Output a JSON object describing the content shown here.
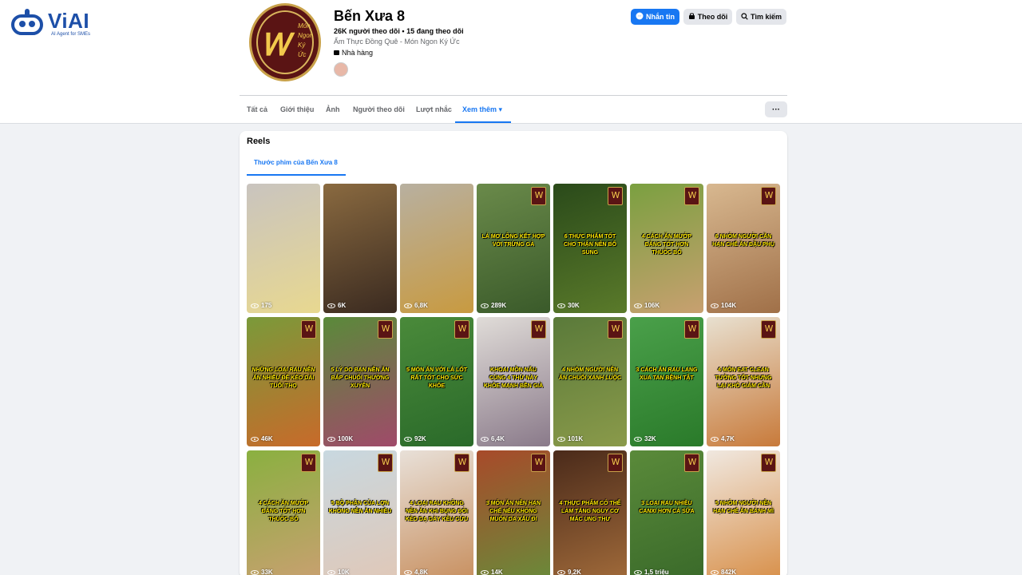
{
  "brand": {
    "name": "ViAI",
    "tagline": "AI Agent for SMEs"
  },
  "page": {
    "name": "Bến Xưa 8",
    "stats": "26K người theo dõi • 15 đang theo dõi",
    "description": "Ẩm Thực Đồng Quê - Món Ngon Ký Ức",
    "category": "Nhà hàng",
    "avatar_text": [
      "Món",
      "Ngon",
      "Ký",
      "Ức"
    ]
  },
  "actions": {
    "message": "Nhắn tin",
    "follow": "Theo dõi",
    "search": "Tìm kiếm",
    "more": "···"
  },
  "tabs": [
    {
      "label": "Tất cả"
    },
    {
      "label": "Giới thiệu"
    },
    {
      "label": "Ảnh"
    },
    {
      "label": "Người theo dõi"
    },
    {
      "label": "Lượt nhắc"
    },
    {
      "label": "Xem thêm ▾",
      "active": true
    }
  ],
  "reels_section": {
    "title": "Reels",
    "subtab": "Thước phim của Bến Xưa 8"
  },
  "reels": [
    {
      "views": "175",
      "caption": "",
      "colors": [
        "#c9c4bf",
        "#e8d890"
      ]
    },
    {
      "views": "6K",
      "caption": "",
      "colors": [
        "#8a6a40",
        "#3a2a20"
      ]
    },
    {
      "views": "6,8K",
      "caption": "",
      "colors": [
        "#b8b0a0",
        "#c89a40"
      ]
    },
    {
      "views": "289K",
      "caption": "Lá mơ lông kết hợp với trứng gà",
      "colors": [
        "#6a8a4a",
        "#3a5a2a"
      ]
    },
    {
      "views": "30K",
      "caption": "6 thực phẩm tốt cho thận nên bổ sung",
      "colors": [
        "#2a4a1a",
        "#5a7a2a"
      ]
    },
    {
      "views": "106K",
      "caption": "4 cách ăn mướp đắng tốt hơn thuốc bổ",
      "colors": [
        "#7aa040",
        "#c8a070"
      ]
    },
    {
      "views": "104K",
      "caption": "6 nhóm người cần hạn chế ăn đậu phụ",
      "colors": [
        "#d8b890",
        "#a07048"
      ]
    },
    {
      "views": "46K",
      "caption": "Những loại rau nên ăn nhiều để kéo dài tuổi thọ",
      "colors": [
        "#7a9a3a",
        "#c86a2a"
      ]
    },
    {
      "views": "100K",
      "caption": "5 lý do bạn nên ăn bắp chuối thường xuyên",
      "colors": [
        "#5a8a3a",
        "#a04a6a"
      ]
    },
    {
      "views": "92K",
      "caption": "5 món ăn với lá lốt rất tốt cho sức khỏe",
      "colors": [
        "#4a8a3a",
        "#2a6a2a"
      ]
    },
    {
      "views": "6,4K",
      "caption": "Khoai môn nấu cùng 4 thứ này khỏe mạnh bền già",
      "colors": [
        "#e0dcd8",
        "#8a7a8a"
      ]
    },
    {
      "views": "101K",
      "caption": "4 nhóm người nên ăn chuối xanh luộc",
      "colors": [
        "#5a7a3a",
        "#8a9a4a"
      ]
    },
    {
      "views": "32K",
      "caption": "3 cách ăn rau lang xua tan bệnh tật",
      "colors": [
        "#4aa04a",
        "#2a7a2a"
      ]
    },
    {
      "views": "4,7K",
      "caption": "4 món eat clean tưởng tốt nhưng lại khó giảm cân",
      "colors": [
        "#e8e0d0",
        "#c87a3a"
      ]
    },
    {
      "views": "33K",
      "caption": "4 cách ăn mướp đắng tốt hơn thuốc bổ",
      "colors": [
        "#8ab040",
        "#c8a070"
      ]
    },
    {
      "views": "10K",
      "caption": "5 bộ phận của lợn không nên ăn nhiều",
      "colors": [
        "#c8d8e0",
        "#e0c8b8"
      ]
    },
    {
      "views": "4,8K",
      "caption": "4 loại rau không nên ăn khi bụng đói kẻo dạ dày kêu cứu",
      "colors": [
        "#e8e0d8",
        "#c89060"
      ]
    },
    {
      "views": "14K",
      "caption": "3 món ăn nên hạn chế nếu không muốn da xấu đi",
      "colors": [
        "#a84a2a",
        "#6a8a3a"
      ]
    },
    {
      "views": "9,2K",
      "caption": "4 thực phẩm có thể làm tăng nguy cơ mắc ung thư",
      "colors": [
        "#4a2a1a",
        "#a06a3a"
      ]
    },
    {
      "views": "1,5 triệu",
      "caption": "3 loại rau nhiều canxi hơn cả sữa",
      "colors": [
        "#5a8a3a",
        "#3a6a2a"
      ]
    },
    {
      "views": "842K",
      "caption": "5 nhóm người nên hạn chế ăn bánh mì",
      "colors": [
        "#f0e8e0",
        "#d8904a"
      ]
    }
  ]
}
